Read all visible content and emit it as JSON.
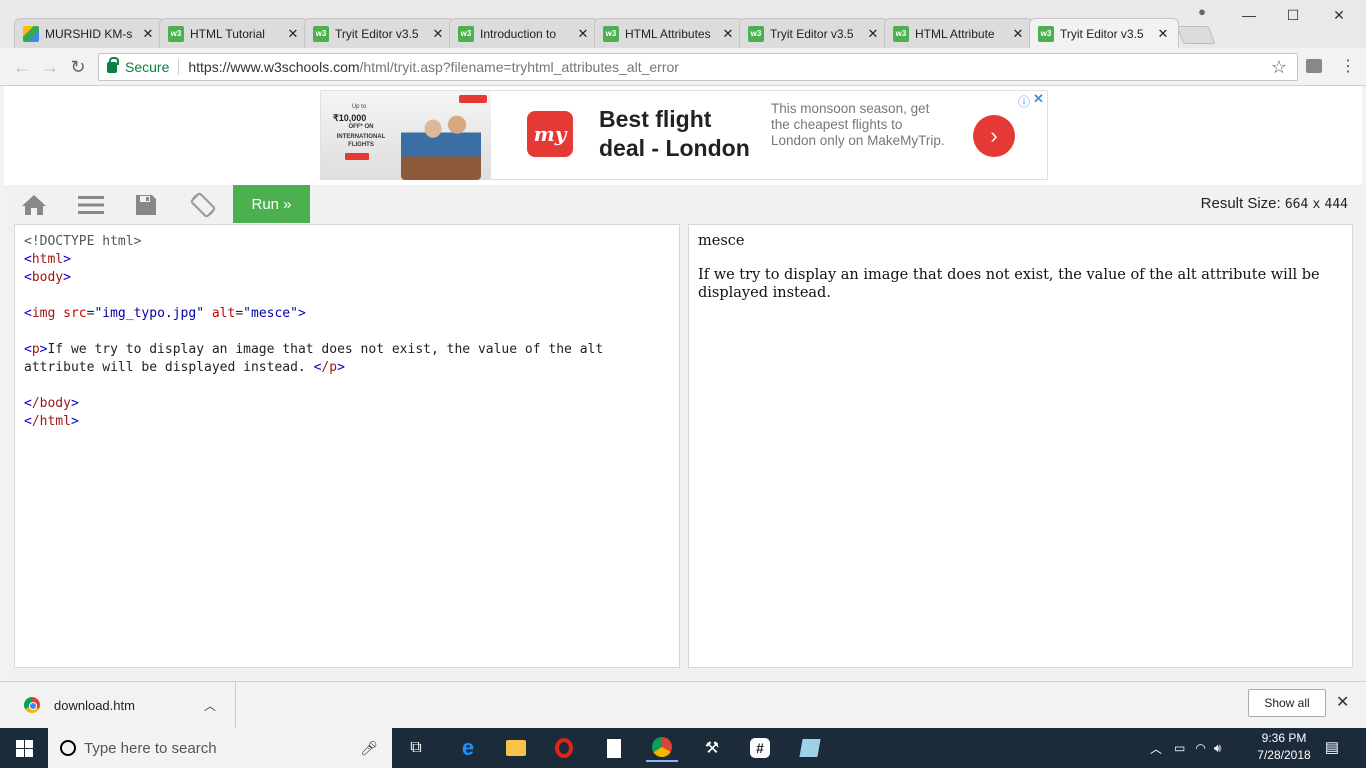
{
  "browser": {
    "tabs": [
      {
        "label": "MURSHID KM-s",
        "favicon": "google-drive-icon",
        "active": false
      },
      {
        "label": "HTML Tutorial",
        "favicon": "w3schools-icon",
        "active": false
      },
      {
        "label": "Tryit Editor v3.5",
        "favicon": "w3schools-icon",
        "active": false
      },
      {
        "label": "Introduction to",
        "favicon": "w3schools-icon",
        "active": false
      },
      {
        "label": "HTML Attributes",
        "favicon": "w3schools-icon",
        "active": false
      },
      {
        "label": "Tryit Editor v3.5",
        "favicon": "w3schools-icon",
        "active": false
      },
      {
        "label": "HTML Attribute",
        "favicon": "w3schools-icon",
        "active": false
      },
      {
        "label": "Tryit Editor v3.5",
        "favicon": "w3schools-icon",
        "active": true
      }
    ],
    "secure_label": "Secure",
    "url_host": "https://www.w3schools.com",
    "url_path": "/html/tryit.asp?filename=tryhtml_attributes_alt_error"
  },
  "ad": {
    "image_small": "Up to",
    "image_price": "₹10,000",
    "image_off": "OFF* ON",
    "image_intl": "INTERNATIONAL FLIGHTS",
    "logo_text": "my",
    "headline": "Best flight deal - London",
    "body": "This monsoon season, get the cheapest flights to London only on MakeMyTrip.",
    "cta_icon": "chevron-right-icon"
  },
  "tryit": {
    "run_label": "Run »",
    "result_size_label": "Result Size:",
    "result_width": "664",
    "result_times": "x",
    "result_height": "444"
  },
  "code": {
    "l1": "<!DOCTYPE html>",
    "l2_tag": "html",
    "l3_tag": "body",
    "img_tag": "img",
    "src_attr": "src",
    "src_val": "\"img_typo.jpg\"",
    "alt_attr": "alt",
    "alt_val": "\"mesce\"",
    "p_tag": "p",
    "p_text_1": "If we try to display an image that does not exist, the value of the alt",
    "p_text_2": "attribute will be displayed instead. ",
    "close_p": "/p",
    "close_body": "/body",
    "close_html": "/html"
  },
  "result": {
    "alt_text": "mesce",
    "paragraph": "If we try to display an image that does not exist, the value of the alt attribute will be displayed instead."
  },
  "downloads": {
    "file_name": "download.htm",
    "show_all": "Show all"
  },
  "taskbar": {
    "search_placeholder": "Type here to search",
    "time": "9:36 PM",
    "date": "7/28/2018"
  },
  "colors": {
    "w3_green": "#4caf50",
    "ad_red": "#e53935",
    "secure_green": "#0b8043",
    "taskbar": "#1c2b3a"
  }
}
